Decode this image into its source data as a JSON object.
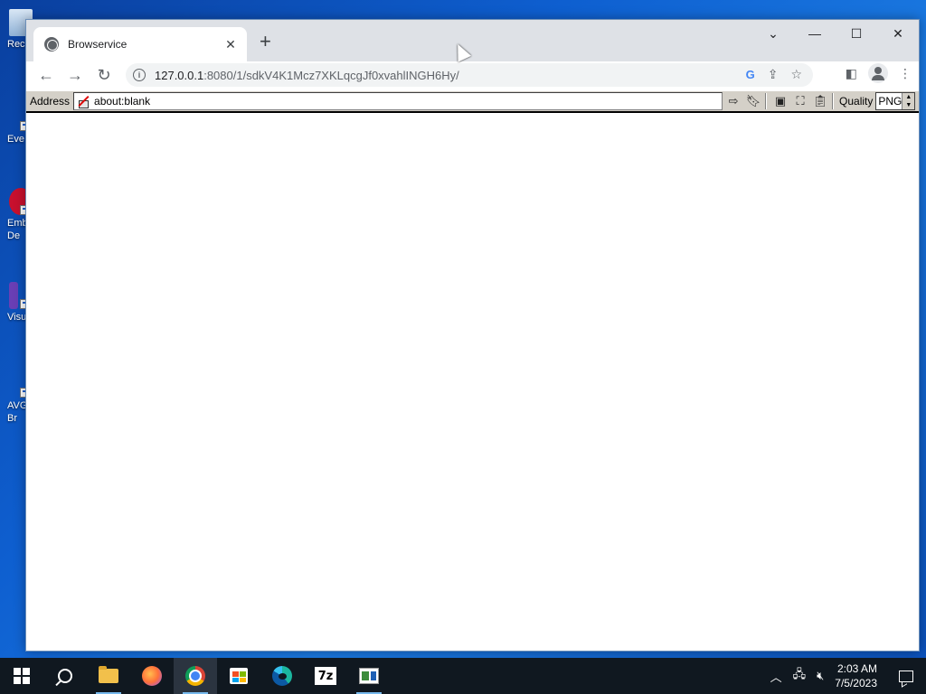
{
  "desktop": {
    "icons": [
      {
        "label": "Rec"
      },
      {
        "label": "Eve"
      },
      {
        "label": "Emb\nDe"
      },
      {
        "label": "Visu"
      },
      {
        "label": "AVG\nBr"
      }
    ]
  },
  "browser": {
    "tab_title": "Browservice",
    "url_host": "127.0.0.1",
    "url_rest": ":8080/1/sdkV4K1Mcz7XKLqcgJf0xvahlINGH6Hy/",
    "window_controls": {
      "tab_search": "⌄",
      "minimize": "—",
      "maximize": "☐",
      "close": "✕"
    }
  },
  "browservice_bar": {
    "address_label": "Address",
    "address_value": "about:blank",
    "quality_label": "Quality",
    "quality_value": "PNG"
  },
  "taskbar": {
    "items": [
      {
        "name": "start-button",
        "icon": "windows-logo-icon"
      },
      {
        "name": "search-button",
        "icon": "search-icon"
      },
      {
        "name": "file-explorer",
        "icon": "folder-icon"
      },
      {
        "name": "firefox",
        "icon": "firefox-icon"
      },
      {
        "name": "chrome",
        "icon": "chrome-icon"
      },
      {
        "name": "microsoft-store",
        "icon": "store-icon"
      },
      {
        "name": "edge",
        "icon": "edge-icon"
      },
      {
        "name": "7zip",
        "icon": "7zip-icon",
        "label": "7z"
      },
      {
        "name": "app",
        "icon": "window-app-icon"
      }
    ],
    "clock_time": "2:03 AM",
    "clock_date": "7/5/2023"
  },
  "colors": {
    "desktop_bg": "#0e5fd0",
    "taskbar_bg": "#101820",
    "tabstrip_bg": "#dee1e6",
    "browservice_bar_bg": "#d4d0c8"
  }
}
